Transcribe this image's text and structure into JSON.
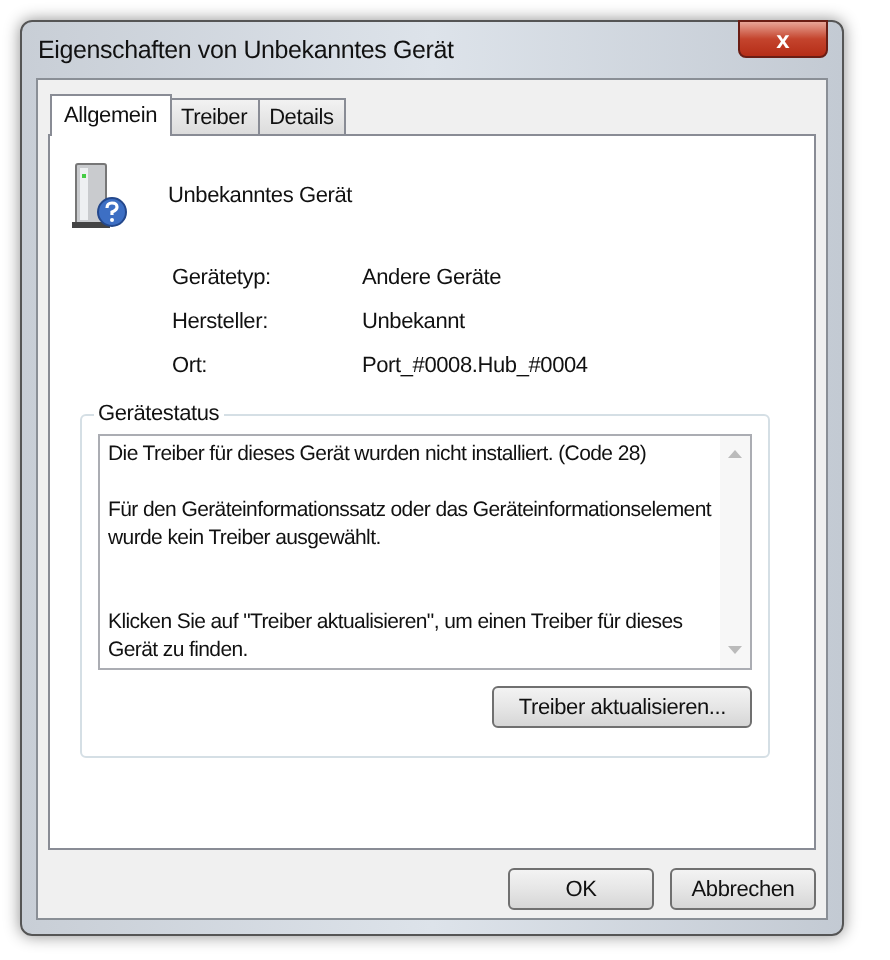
{
  "window": {
    "title": "Eigenschaften von Unbekanntes Gerät",
    "close": "x"
  },
  "tabs": [
    {
      "label": "Allgemein",
      "selected": true
    },
    {
      "label": "Treiber",
      "selected": false
    },
    {
      "label": "Details",
      "selected": false
    }
  ],
  "device": {
    "name": "Unbekanntes Gerät"
  },
  "properties": [
    {
      "label": "Gerätetyp:",
      "value": "Andere Geräte"
    },
    {
      "label": "Hersteller:",
      "value": "Unbekannt"
    },
    {
      "label": "Ort:",
      "value": "Port_#0008.Hub_#0004"
    }
  ],
  "status": {
    "title": "Gerätestatus",
    "paragraphs": [
      "Die Treiber für dieses Gerät wurden nicht installiert. (Code 28)",
      "Für den Geräteinformationssatz oder das Geräteinformationselement wurde kein Treiber ausgewählt.",
      "Klicken Sie auf \"Treiber aktualisieren\", um einen Treiber für dieses Gerät zu finden."
    ],
    "button": "Treiber aktualisieren..."
  },
  "buttons": [
    "OK",
    "Abbrechen"
  ]
}
